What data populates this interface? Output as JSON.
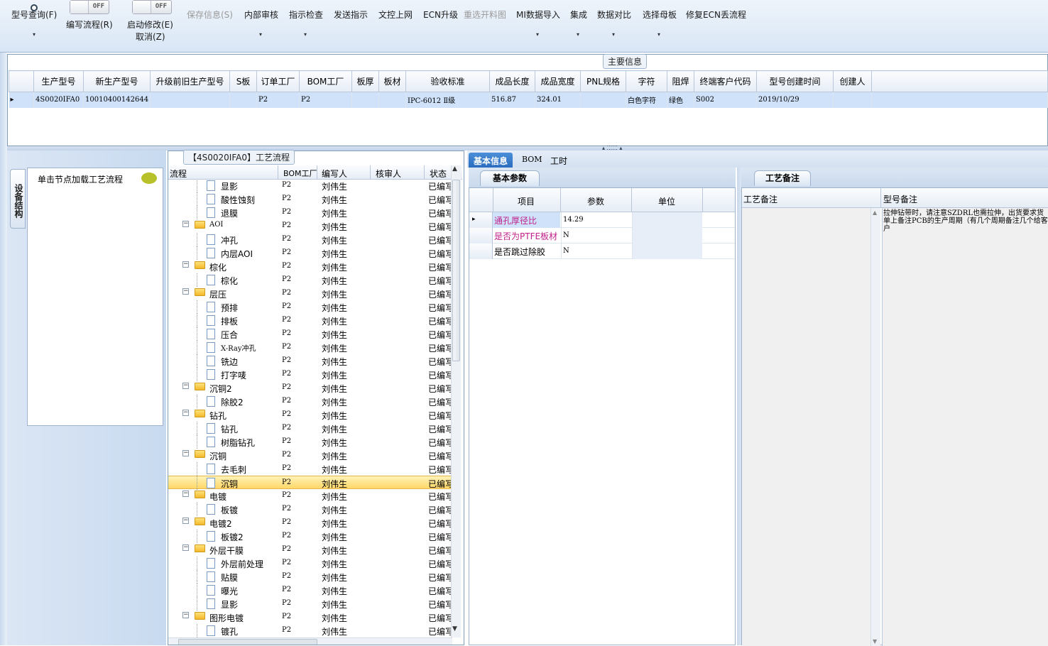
{
  "toolbar": {
    "model_query": "型号查询(F)",
    "write_flow": "编写流程(R)",
    "start_modify": "启动修改(E)",
    "cancel": "取消(Z)",
    "save_info": "保存信息(S)",
    "internal_review": "内部审核",
    "instruction_check": "指示检查",
    "send_instruction": "发送指示",
    "doc_upload": "文控上网",
    "ecn_upgrade": "ECN升级",
    "reselect_cut": "重选开料图",
    "mi_import": "MI数据导入",
    "integrate": "集成",
    "data_compare": "数据对比",
    "select_mother": "选择母板",
    "repair_ecn": "修复ECN丢流程",
    "toggle_off": "OFF"
  },
  "main_info": {
    "caption": "主要信息",
    "columns": [
      "生产型号",
      "新生产型号",
      "升级前旧生产型号",
      "S板",
      "订单工厂",
      "BOM工厂",
      "板厚",
      "板材",
      "验收标准",
      "成品长度",
      "成品宽度",
      "PNL规格",
      "字符",
      "阻焊",
      "终端客户代码",
      "型号创建时间",
      "创建人"
    ],
    "row": [
      "4S0020IFA0",
      "10010400142644",
      "",
      "",
      "P2",
      "P2",
      "",
      "",
      "IPC-6012 Ⅱ级",
      "516.87",
      "324.01",
      "",
      "白色字符",
      "绿色",
      "S002",
      "2019/10/29",
      ""
    ]
  },
  "left_panel": {
    "side_tab": "设备结构",
    "node_hint": "单击节点加载工艺流程"
  },
  "flow_panel": {
    "caption": "【4S0020IFA0】工艺流程",
    "headers": {
      "process": "流程",
      "bom_factory": "BOM工厂",
      "writer": "编写人",
      "reviewer": "核审人",
      "status": "状态"
    },
    "rows": [
      {
        "name": "显影",
        "type": "doc",
        "bom": "P2",
        "writer": "刘伟生",
        "status": "已编写"
      },
      {
        "name": "酸性蚀刻",
        "type": "doc",
        "bom": "P2",
        "writer": "刘伟生",
        "status": "已编写"
      },
      {
        "name": "退膜",
        "type": "doc",
        "bom": "P2",
        "writer": "刘伟生",
        "status": "已编写"
      },
      {
        "name": "AOI",
        "type": "folder",
        "bom": "P2",
        "writer": "刘伟生",
        "status": "已编写"
      },
      {
        "name": "冲孔",
        "type": "doc",
        "bom": "P2",
        "writer": "刘伟生",
        "status": "已编写"
      },
      {
        "name": "内层AOI",
        "type": "doc",
        "bom": "P2",
        "writer": "刘伟生",
        "status": "已编写"
      },
      {
        "name": "棕化",
        "type": "folder",
        "bom": "P2",
        "writer": "刘伟生",
        "status": "已编写"
      },
      {
        "name": "棕化",
        "type": "doc",
        "bom": "P2",
        "writer": "刘伟生",
        "status": "已编写"
      },
      {
        "name": "层压",
        "type": "folder",
        "bom": "P2",
        "writer": "刘伟生",
        "status": "已编写"
      },
      {
        "name": "预排",
        "type": "doc",
        "bom": "P2",
        "writer": "刘伟生",
        "status": "已编写"
      },
      {
        "name": "排板",
        "type": "doc",
        "bom": "P2",
        "writer": "刘伟生",
        "status": "已编写"
      },
      {
        "name": "压合",
        "type": "doc",
        "bom": "P2",
        "writer": "刘伟生",
        "status": "已编写"
      },
      {
        "name": "X-Ray冲孔",
        "type": "doc",
        "bom": "P2",
        "writer": "刘伟生",
        "status": "已编写"
      },
      {
        "name": "铣边",
        "type": "doc",
        "bom": "P2",
        "writer": "刘伟生",
        "status": "已编写"
      },
      {
        "name": "打字唛",
        "type": "doc",
        "bom": "P2",
        "writer": "刘伟生",
        "status": "已编写"
      },
      {
        "name": "沉铜2",
        "type": "folder",
        "bom": "P2",
        "writer": "刘伟生",
        "status": "已编写"
      },
      {
        "name": "除胶2",
        "type": "doc",
        "bom": "P2",
        "writer": "刘伟生",
        "status": "已编写"
      },
      {
        "name": "钻孔",
        "type": "folder",
        "bom": "P2",
        "writer": "刘伟生",
        "status": "已编写"
      },
      {
        "name": "钻孔",
        "type": "doc",
        "bom": "P2",
        "writer": "刘伟生",
        "status": "已编写"
      },
      {
        "name": "树脂钻孔",
        "type": "doc",
        "bom": "P2",
        "writer": "刘伟生",
        "status": "已编写"
      },
      {
        "name": "沉铜",
        "type": "folder",
        "bom": "P2",
        "writer": "刘伟生",
        "status": "已编写"
      },
      {
        "name": "去毛刺",
        "type": "doc",
        "bom": "P2",
        "writer": "刘伟生",
        "status": "已编写"
      },
      {
        "name": "沉铜",
        "type": "doc",
        "bom": "P2",
        "writer": "刘伟生",
        "status": "已编写",
        "selected": true
      },
      {
        "name": "电镀",
        "type": "folder",
        "bom": "P2",
        "writer": "刘伟生",
        "status": "已编写"
      },
      {
        "name": "板镀",
        "type": "doc",
        "bom": "P2",
        "writer": "刘伟生",
        "status": "已编写"
      },
      {
        "name": "电镀2",
        "type": "folder",
        "bom": "P2",
        "writer": "刘伟生",
        "status": "已编写"
      },
      {
        "name": "板镀2",
        "type": "doc",
        "bom": "P2",
        "writer": "刘伟生",
        "status": "已编写"
      },
      {
        "name": "外层干膜",
        "type": "folder",
        "bom": "P2",
        "writer": "刘伟生",
        "status": "已编写"
      },
      {
        "name": "外层前处理",
        "type": "doc",
        "bom": "P2",
        "writer": "刘伟生",
        "status": "已编写"
      },
      {
        "name": "贴膜",
        "type": "doc",
        "bom": "P2",
        "writer": "刘伟生",
        "status": "已编写"
      },
      {
        "name": "曝光",
        "type": "doc",
        "bom": "P2",
        "writer": "刘伟生",
        "status": "已编写"
      },
      {
        "name": "显影",
        "type": "doc",
        "bom": "P2",
        "writer": "刘伟生",
        "status": "已编写"
      },
      {
        "name": "图形电镀",
        "type": "folder",
        "bom": "P2",
        "writer": "刘伟生",
        "status": "已编写"
      },
      {
        "name": "镀孔",
        "type": "doc",
        "bom": "P2",
        "writer": "刘伟生",
        "status": "已编写"
      }
    ]
  },
  "right_tabs": {
    "basic": "基本信息",
    "bom": "BOM",
    "hours": "工时"
  },
  "basic_params": {
    "group": "基本参数",
    "headers": {
      "item": "项目",
      "param": "参数",
      "unit": "单位"
    },
    "rows": [
      {
        "item": "通孔厚径比",
        "param": "14.29",
        "unit": ""
      },
      {
        "item": "是否为PTFE板材",
        "param": "N",
        "unit": ""
      },
      {
        "item": "是否跳过除胶",
        "param": "N",
        "unit": ""
      }
    ]
  },
  "process_notes": {
    "group": "工艺备注",
    "col_process": "工艺备注",
    "col_model": "型号备注",
    "model_note": "拉伸钻带时，请注意SZDRL也需拉伸，出货要求货单上备注PCB的生产周期（有几个周期备注几个给客户"
  },
  "colors": {
    "accent": "#2b6cbf",
    "selection": "#cfe2fa",
    "highlight": "#ffd768",
    "pink_text": "#c0208a"
  }
}
